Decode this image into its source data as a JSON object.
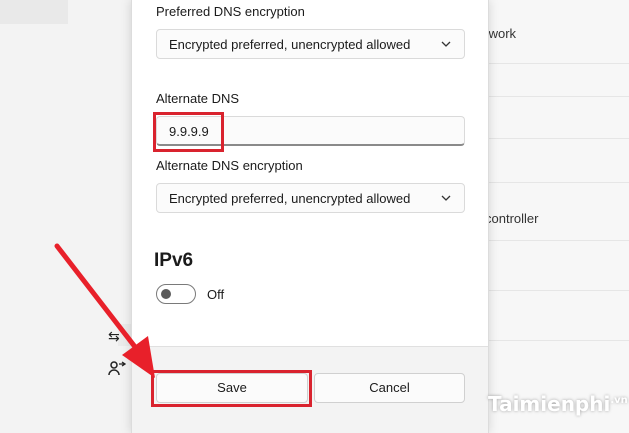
{
  "background": {
    "network_text": "twork",
    "controller_text": "controller"
  },
  "dialog": {
    "preferred_dns_encryption": {
      "label": "Preferred DNS encryption",
      "value": "Encrypted preferred, unencrypted allowed"
    },
    "alternate_dns": {
      "label": "Alternate DNS",
      "value": "9.9.9.9"
    },
    "alternate_dns_encryption": {
      "label": "Alternate DNS encryption",
      "value": "Encrypted preferred, unencrypted allowed"
    },
    "ipv6": {
      "heading": "IPv6",
      "toggle_state": "Off"
    },
    "buttons": {
      "save": "Save",
      "cancel": "Cancel"
    }
  },
  "watermark": {
    "text": "aimienphi",
    "suffix": ".vn"
  },
  "colors": {
    "highlight": "#d9232e",
    "arrow": "#e8202a"
  }
}
